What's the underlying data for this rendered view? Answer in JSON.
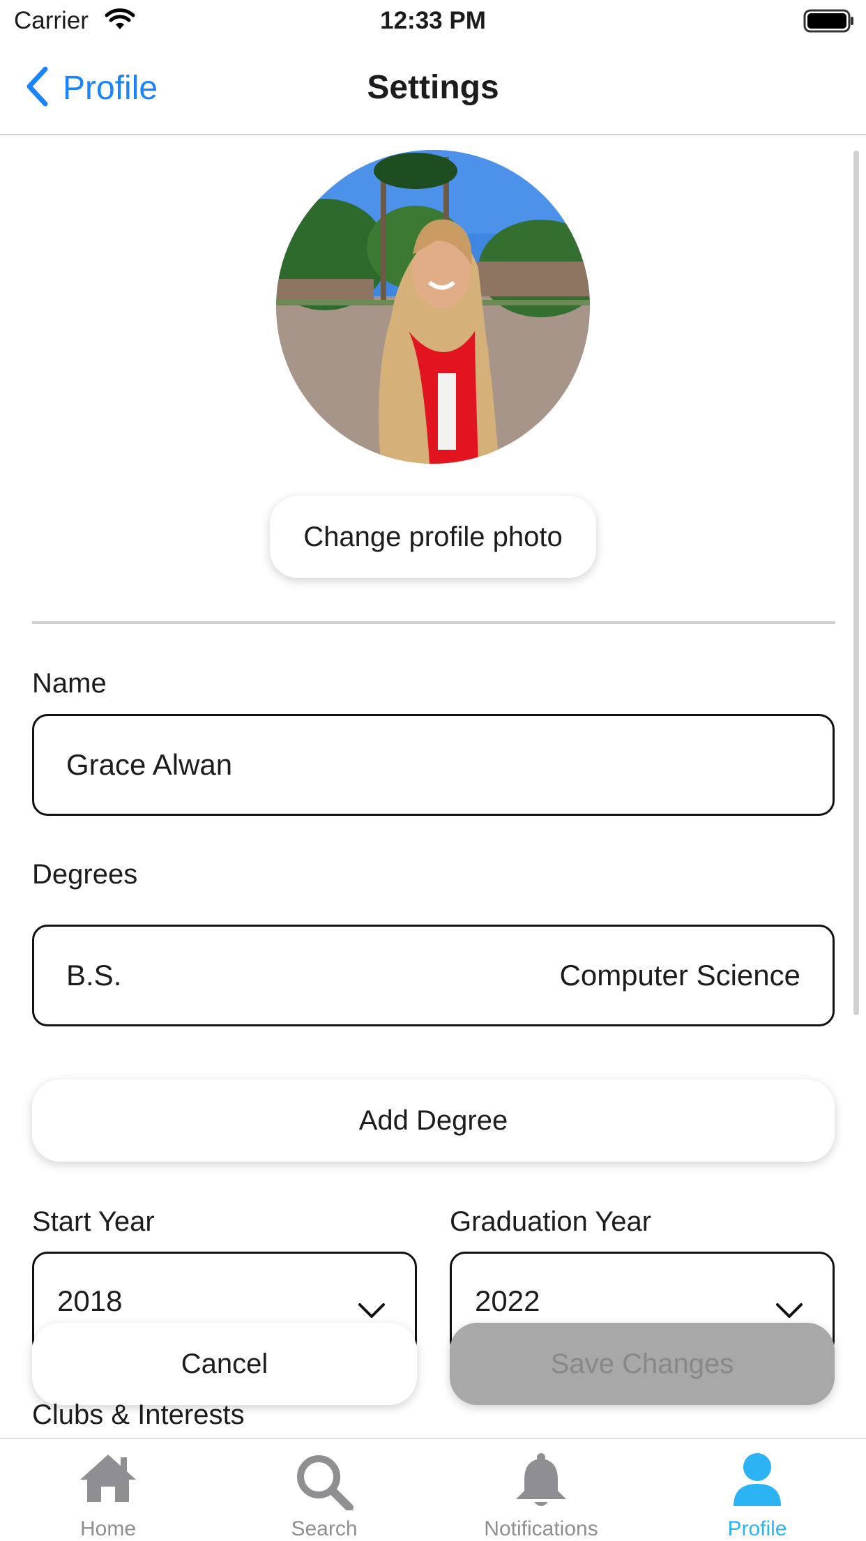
{
  "status_bar": {
    "carrier": "Carrier",
    "time": "12:33 PM"
  },
  "nav": {
    "back_label": "Profile",
    "title": "Settings"
  },
  "profile_photo": {
    "change_label": "Change profile photo"
  },
  "form": {
    "name_label": "Name",
    "name_value": "Grace Alwan",
    "degrees_label": "Degrees",
    "degree_type": "B.S.",
    "degree_major": "Computer Science",
    "add_degree_label": "Add Degree",
    "start_year_label": "Start Year",
    "start_year_value": "2018",
    "grad_year_label": "Graduation Year",
    "grad_year_value": "2022",
    "clubs_label": "Clubs & Interests"
  },
  "actions": {
    "cancel_label": "Cancel",
    "save_label": "Save Changes",
    "save_enabled": false
  },
  "tabs": [
    {
      "label": "Home",
      "icon": "house-icon"
    },
    {
      "label": "Search",
      "icon": "magnifier-icon"
    },
    {
      "label": "Notifications",
      "icon": "bell-icon"
    },
    {
      "label": "Profile",
      "icon": "person-icon",
      "active": true
    }
  ],
  "colors": {
    "accent": "#1a84ff",
    "active_tab": "#2bb3f3",
    "inactive_tab": "#8e8e93",
    "disabled_button": "#a8a8a8"
  }
}
